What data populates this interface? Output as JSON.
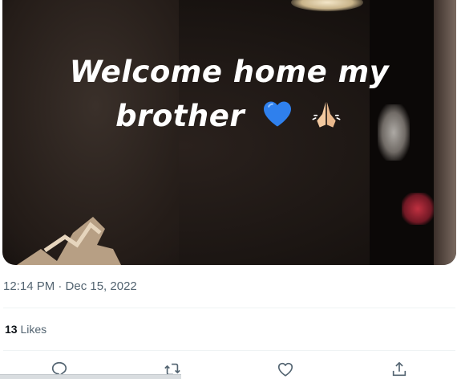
{
  "tweet": {
    "media": {
      "caption_line1": "Welcome home my",
      "caption_line2": "brother",
      "emoji_icons": [
        "blue-heart-icon",
        "folded-hands-icon"
      ]
    },
    "timestamp": "12:14 PM · Dec 15, 2022",
    "likes": {
      "count": "13",
      "label": "Likes"
    },
    "actions": [
      "reply-icon",
      "retweet-icon",
      "like-icon",
      "share-icon"
    ]
  },
  "colors": {
    "text_primary": "#0f1419",
    "text_secondary": "#536471",
    "divider": "#eff3f4",
    "heart_blue": "#2f80ed"
  }
}
